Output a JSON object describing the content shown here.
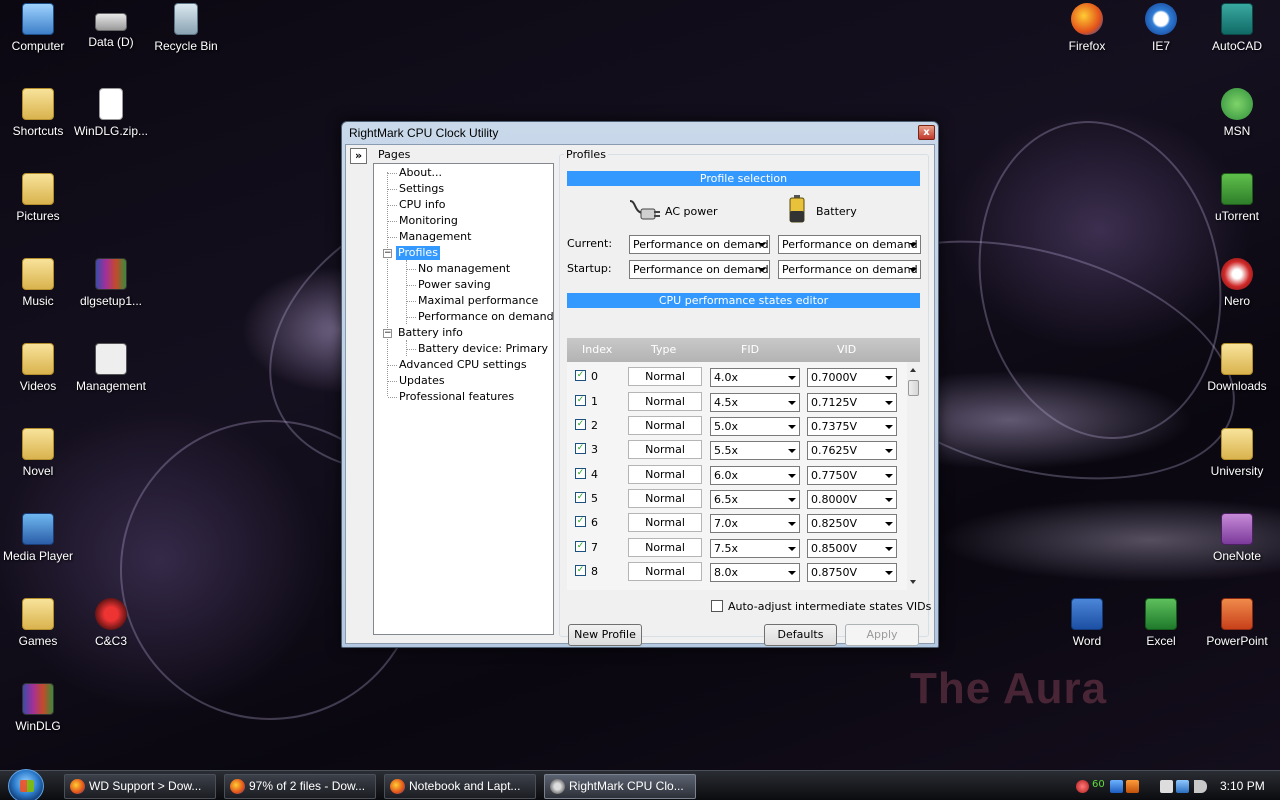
{
  "desktop": {
    "icons": [
      {
        "label": "Computer",
        "icon": "computer-icon"
      },
      {
        "label": "Data (D)",
        "icon": "drive-icon"
      },
      {
        "label": "Recycle Bin",
        "icon": "recycle-bin-icon"
      },
      {
        "label": "Shortcuts",
        "icon": "folder-icon"
      },
      {
        "label": "WinDLG.zip...",
        "icon": "document-icon"
      },
      {
        "label": "Pictures",
        "icon": "folder-icon"
      },
      {
        "label": "Music",
        "icon": "folder-icon"
      },
      {
        "label": "dlgsetup1...",
        "icon": "winrar-icon"
      },
      {
        "label": "Videos",
        "icon": "folder-icon"
      },
      {
        "label": "Management",
        "icon": "management-icon"
      },
      {
        "label": "Novel",
        "icon": "folder-icon"
      },
      {
        "label": "Media Player",
        "icon": "media-player-icon"
      },
      {
        "label": "Games",
        "icon": "folder-icon"
      },
      {
        "label": "C&C3",
        "icon": "cnc3-icon"
      },
      {
        "label": "WinDLG",
        "icon": "winrar-icon"
      },
      {
        "label": "Firefox",
        "icon": "firefox-icon"
      },
      {
        "label": "IE7",
        "icon": "ie7-icon"
      },
      {
        "label": "AutoCAD",
        "icon": "autocad-icon"
      },
      {
        "label": "MSN",
        "icon": "msn-icon"
      },
      {
        "label": "uTorrent",
        "icon": "utorrent-icon"
      },
      {
        "label": "Nero",
        "icon": "nero-icon"
      },
      {
        "label": "Downloads",
        "icon": "folder-icon"
      },
      {
        "label": "University",
        "icon": "folder-icon"
      },
      {
        "label": "OneNote",
        "icon": "onenote-icon"
      },
      {
        "label": "Word",
        "icon": "word-icon"
      },
      {
        "label": "Excel",
        "icon": "excel-icon"
      },
      {
        "label": "PowerPoint",
        "icon": "powerpoint-icon"
      }
    ],
    "watermark": "The Aura"
  },
  "window": {
    "title": "RightMark CPU Clock Utility",
    "close_glyph": "x",
    "expand_glyph": "»",
    "pages_label": "Pages",
    "tree": [
      {
        "label": "About..."
      },
      {
        "label": "Settings"
      },
      {
        "label": "CPU info"
      },
      {
        "label": "Monitoring"
      },
      {
        "label": "Management"
      },
      {
        "label": "Profiles",
        "expander": "−"
      },
      {
        "label": "No management"
      },
      {
        "label": "Power saving"
      },
      {
        "label": "Maximal performance"
      },
      {
        "label": "Performance on demand"
      },
      {
        "label": "Battery info",
        "expander": "−"
      },
      {
        "label": "Battery device: Primary"
      },
      {
        "label": "Advanced CPU settings"
      },
      {
        "label": "Updates"
      },
      {
        "label": "Professional features"
      }
    ],
    "profiles": {
      "group_label": "Profiles",
      "selection_header": "Profile selection",
      "ac_label": "AC power",
      "battery_label": "Battery",
      "current_label": "Current:",
      "startup_label": "Startup:",
      "current_ac": "Performance on demand",
      "current_battery": "Performance on demand",
      "startup_ac": "Performance on demand",
      "startup_battery": "Performance on demand",
      "editor_header": "CPU performance states editor",
      "columns": [
        "Index",
        "Type",
        "FID",
        "VID"
      ],
      "states": [
        {
          "index": "0",
          "type": "Normal",
          "fid": "4.0x",
          "vid": "0.7000V"
        },
        {
          "index": "1",
          "type": "Normal",
          "fid": "4.5x",
          "vid": "0.7125V"
        },
        {
          "index": "2",
          "type": "Normal",
          "fid": "5.0x",
          "vid": "0.7375V"
        },
        {
          "index": "3",
          "type": "Normal",
          "fid": "5.5x",
          "vid": "0.7625V"
        },
        {
          "index": "4",
          "type": "Normal",
          "fid": "6.0x",
          "vid": "0.7750V"
        },
        {
          "index": "5",
          "type": "Normal",
          "fid": "6.5x",
          "vid": "0.8000V"
        },
        {
          "index": "6",
          "type": "Normal",
          "fid": "7.0x",
          "vid": "0.8250V"
        },
        {
          "index": "7",
          "type": "Normal",
          "fid": "7.5x",
          "vid": "0.8500V"
        },
        {
          "index": "8",
          "type": "Normal",
          "fid": "8.0x",
          "vid": "0.8750V"
        }
      ],
      "check_glyph": "✓",
      "auto_adjust_label": "Auto-adjust intermediate states VIDs",
      "new_profile_label": "New Profile",
      "defaults_label": "Defaults",
      "apply_label": "Apply"
    }
  },
  "taskbar": {
    "buttons": [
      {
        "label": "WD Support > Dow...",
        "icon": "firefox-icon"
      },
      {
        "label": "97% of 2 files - Dow...",
        "icon": "firefox-icon"
      },
      {
        "label": "Notebook and Lapt...",
        "icon": "firefox-icon"
      },
      {
        "label": "RightMark CPU Clo...",
        "icon": "gear-icon"
      }
    ],
    "tray_temp": "60",
    "clock": "3:10 PM"
  },
  "colors": {
    "accent": "#3399ff",
    "grid_header": "#b8b8b8"
  }
}
